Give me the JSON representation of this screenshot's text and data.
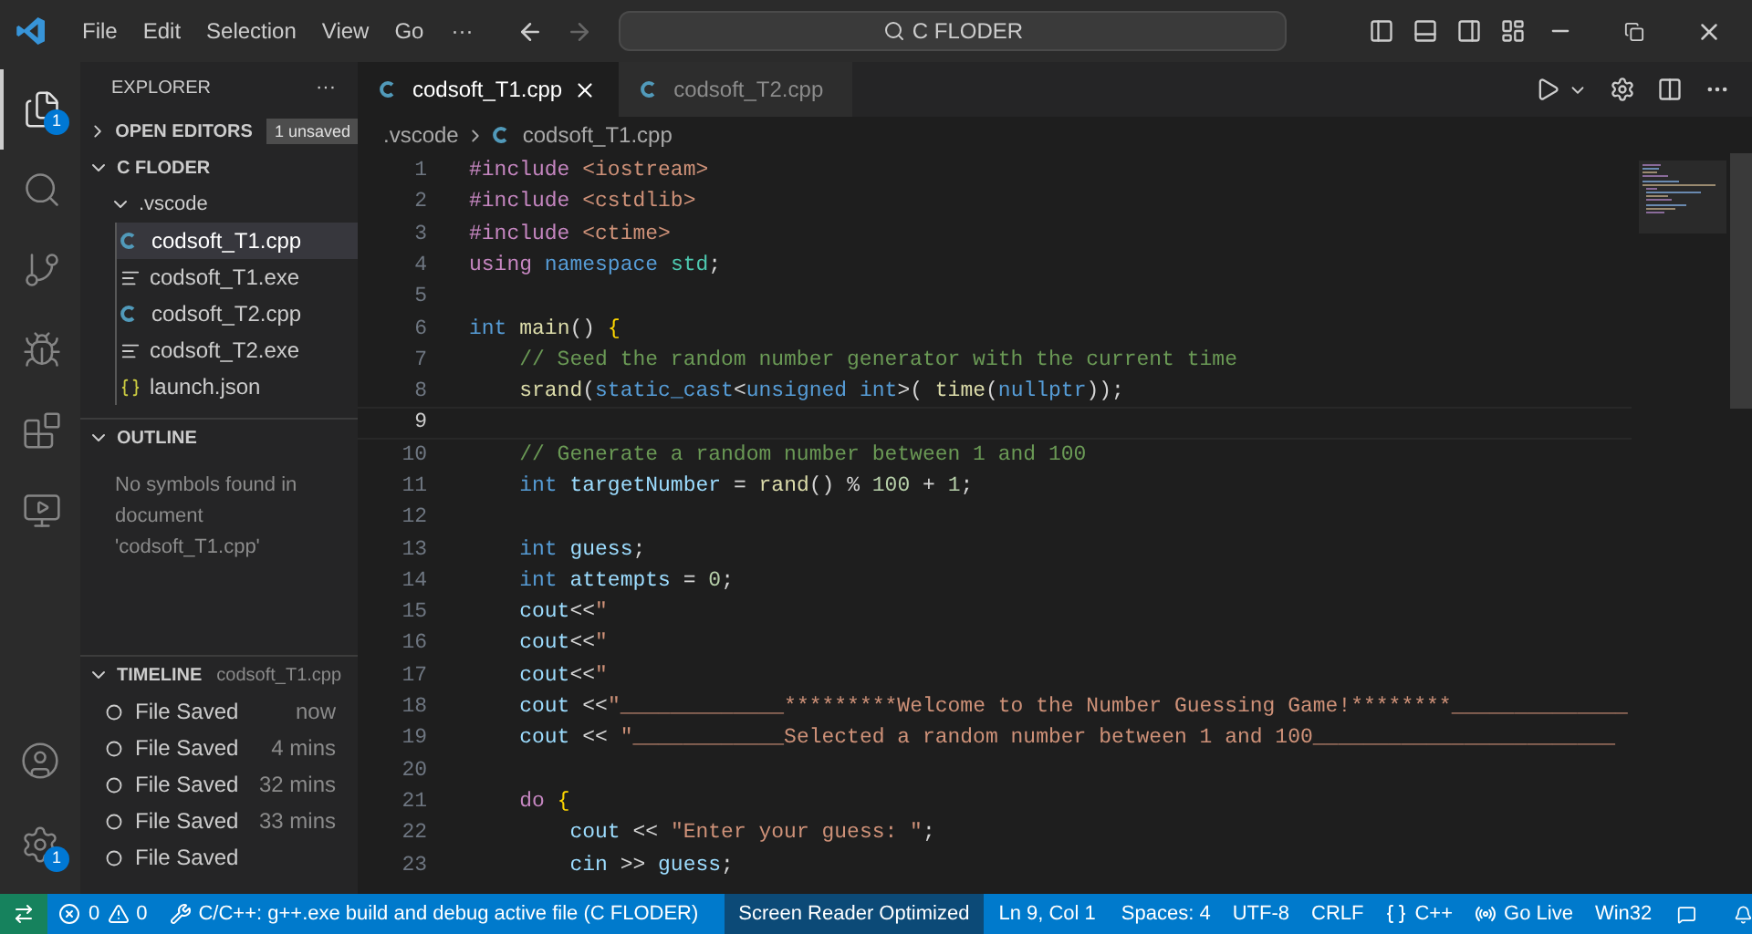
{
  "title_bar": {
    "menu": [
      "File",
      "Edit",
      "Selection",
      "View",
      "Go"
    ],
    "more": "···",
    "search": "C FLODER"
  },
  "activity_bar": {
    "items": [
      {
        "kind": "files",
        "selected": true,
        "badge": "1"
      },
      {
        "kind": "search",
        "selected": false
      },
      {
        "kind": "git",
        "selected": false
      },
      {
        "kind": "debug",
        "selected": false
      },
      {
        "kind": "extensions",
        "selected": false
      },
      {
        "kind": "remote",
        "selected": false
      }
    ],
    "bottom": [
      {
        "kind": "account"
      },
      {
        "kind": "settings",
        "badge": "1"
      }
    ]
  },
  "sidebar": {
    "title": "EXPLORER",
    "more": "···",
    "open_editors": {
      "label": "OPEN EDITORS",
      "expanded": false,
      "badge": "1 unsaved"
    },
    "folder": {
      "label": "C FLODER",
      "expanded": true,
      "children": [
        {
          "label": ".vscode",
          "kind": "folder",
          "expanded": true,
          "selected": false,
          "children": [
            {
              "label": "codsoft_T1.cpp",
              "kind": "cpp",
              "selected": true
            },
            {
              "label": "codsoft_T1.exe",
              "kind": "exe",
              "selected": false
            },
            {
              "label": "codsoft_T2.cpp",
              "kind": "cpp",
              "selected": false
            },
            {
              "label": "codsoft_T2.exe",
              "kind": "exe",
              "selected": false
            },
            {
              "label": "launch.json",
              "kind": "json",
              "selected": false
            }
          ]
        }
      ]
    },
    "outline": {
      "label": "OUTLINE",
      "expanded": true,
      "message": "No symbols found in document 'codsoft_T1.cpp'"
    },
    "timeline": {
      "label": "TIMELINE",
      "expanded": true,
      "file": "codsoft_T1.cpp",
      "items": [
        {
          "label": "File Saved",
          "time": "now"
        },
        {
          "label": "File Saved",
          "time": "4 mins"
        },
        {
          "label": "File Saved",
          "time": "32 mins"
        },
        {
          "label": "File Saved",
          "time": "33 mins"
        },
        {
          "label": "File Saved"
        }
      ]
    }
  },
  "tabs": [
    {
      "label": "codsoft_T1.cpp",
      "selected": true
    },
    {
      "label": "codsoft_T2.cpp",
      "selected": false
    }
  ],
  "breadcrumb": [
    ".vscode",
    "codsoft_T1.cpp"
  ],
  "editor": {
    "lines": [
      {
        "n": "1",
        "current": false,
        "tokens": [
          {
            "kind": "pp",
            "t": "#include "
          },
          {
            "kind": "str",
            "t": "<iostream>"
          }
        ]
      },
      {
        "n": "2",
        "current": false,
        "tokens": [
          {
            "kind": "pp",
            "t": "#include "
          },
          {
            "kind": "str",
            "t": "<cstdlib>"
          }
        ]
      },
      {
        "n": "3",
        "current": false,
        "tokens": [
          {
            "kind": "pp",
            "t": "#include "
          },
          {
            "kind": "str",
            "t": "<ctime>"
          }
        ]
      },
      {
        "n": "4",
        "current": false,
        "tokens": [
          {
            "kind": "pp",
            "t": "using "
          },
          {
            "kind": "kw",
            "t": "namespace "
          },
          {
            "kind": "type",
            "t": "std"
          },
          {
            "kind": "pl",
            "t": ";"
          }
        ]
      },
      {
        "n": "5",
        "current": false
      },
      {
        "n": "6",
        "current": false,
        "tokens": [
          {
            "kind": "kw",
            "t": "int "
          },
          {
            "kind": "fn",
            "t": "main"
          },
          {
            "kind": "pl",
            "t": "() "
          },
          {
            "kind": "br",
            "t": "{"
          }
        ]
      },
      {
        "n": "7",
        "current": false,
        "tokens": [
          {
            "kind": "cm",
            "t": "    // Seed the random number generator with the current time"
          }
        ]
      },
      {
        "n": "8",
        "current": false,
        "tokens": [
          {
            "kind": "fn",
            "t": "    srand"
          },
          {
            "kind": "pl",
            "t": "("
          },
          {
            "kind": "kw",
            "t": "static_cast"
          },
          {
            "kind": "pl",
            "t": "<"
          },
          {
            "kind": "kw",
            "t": "unsigned int"
          },
          {
            "kind": "pl",
            "t": ">( "
          },
          {
            "kind": "fn",
            "t": "time"
          },
          {
            "kind": "pl",
            "t": "("
          },
          {
            "kind": "kw",
            "t": "nullptr"
          },
          {
            "kind": "pl",
            "t": "));"
          }
        ]
      },
      {
        "n": "9",
        "current": true
      },
      {
        "n": "10",
        "current": false,
        "tokens": [
          {
            "kind": "cm",
            "t": "    // Generate a random number between 1 and 100"
          }
        ]
      },
      {
        "n": "11",
        "current": false,
        "tokens": [
          {
            "kind": "kw",
            "t": "    int "
          },
          {
            "kind": "var",
            "t": "targetNumber"
          },
          {
            "kind": "pl",
            "t": " = "
          },
          {
            "kind": "fn",
            "t": "rand"
          },
          {
            "kind": "pl",
            "t": "() % "
          },
          {
            "kind": "num",
            "t": "100"
          },
          {
            "kind": "pl",
            "t": " + "
          },
          {
            "kind": "num",
            "t": "1"
          },
          {
            "kind": "pl",
            "t": ";"
          }
        ]
      },
      {
        "n": "12",
        "current": false
      },
      {
        "n": "13",
        "current": false,
        "tokens": [
          {
            "kind": "kw",
            "t": "    int "
          },
          {
            "kind": "var",
            "t": "guess"
          },
          {
            "kind": "pl",
            "t": ";"
          }
        ]
      },
      {
        "n": "14",
        "current": false,
        "tokens": [
          {
            "kind": "kw",
            "t": "    int "
          },
          {
            "kind": "var",
            "t": "attempts"
          },
          {
            "kind": "pl",
            "t": " = "
          },
          {
            "kind": "num",
            "t": "0"
          },
          {
            "kind": "pl",
            "t": ";"
          }
        ]
      },
      {
        "n": "15",
        "current": false,
        "tokens": [
          {
            "kind": "var",
            "t": "    cout"
          },
          {
            "kind": "pl",
            "t": "<<"
          },
          {
            "kind": "str",
            "t": "\""
          }
        ]
      },
      {
        "n": "16",
        "current": false,
        "tokens": [
          {
            "kind": "var",
            "t": "    cout"
          },
          {
            "kind": "pl",
            "t": "<<"
          },
          {
            "kind": "str",
            "t": "\""
          }
        ]
      },
      {
        "n": "17",
        "current": false,
        "tokens": [
          {
            "kind": "var",
            "t": "    cout"
          },
          {
            "kind": "pl",
            "t": "<<"
          },
          {
            "kind": "str",
            "t": "\""
          }
        ]
      },
      {
        "n": "18",
        "current": false,
        "tokens": [
          {
            "kind": "var",
            "t": "    cout"
          },
          {
            "kind": "pl",
            "t": " <<"
          },
          {
            "kind": "str",
            "t": "\"_____________*********Welcome to the Number Guessing Game!********______________"
          }
        ]
      },
      {
        "n": "19",
        "current": false,
        "tokens": [
          {
            "kind": "var",
            "t": "    cout"
          },
          {
            "kind": "pl",
            "t": " << "
          },
          {
            "kind": "str",
            "t": "\"____________Selected a random number between 1 and 100________________________"
          }
        ]
      },
      {
        "n": "20",
        "current": false
      },
      {
        "n": "21",
        "current": false,
        "tokens": [
          {
            "kind": "pp",
            "t": "    do "
          },
          {
            "kind": "br",
            "t": "{"
          }
        ]
      },
      {
        "n": "22",
        "current": false,
        "tokens": [
          {
            "kind": "var",
            "t": "        cout"
          },
          {
            "kind": "pl",
            "t": " << "
          },
          {
            "kind": "str",
            "t": "\"Enter your guess: \""
          },
          {
            "kind": "pl",
            "t": ";"
          }
        ]
      },
      {
        "n": "23",
        "current": false,
        "tokens": [
          {
            "kind": "var",
            "t": "        cin"
          },
          {
            "kind": "pl",
            "t": " >> "
          },
          {
            "kind": "var",
            "t": "guess"
          },
          {
            "kind": "pl",
            "t": ";"
          }
        ]
      }
    ]
  },
  "status_bar": {
    "errors": "0",
    "warnings": "0",
    "task": "C/C++: g++.exe build and debug active file (C FLODER)",
    "screen_reader": "Screen Reader Optimized",
    "position": "Ln 9, Col 1",
    "spaces": "Spaces: 4",
    "encoding": "UTF-8",
    "eol": "CRLF",
    "language": "C++",
    "live": "Go Live",
    "platform": "Win32"
  }
}
